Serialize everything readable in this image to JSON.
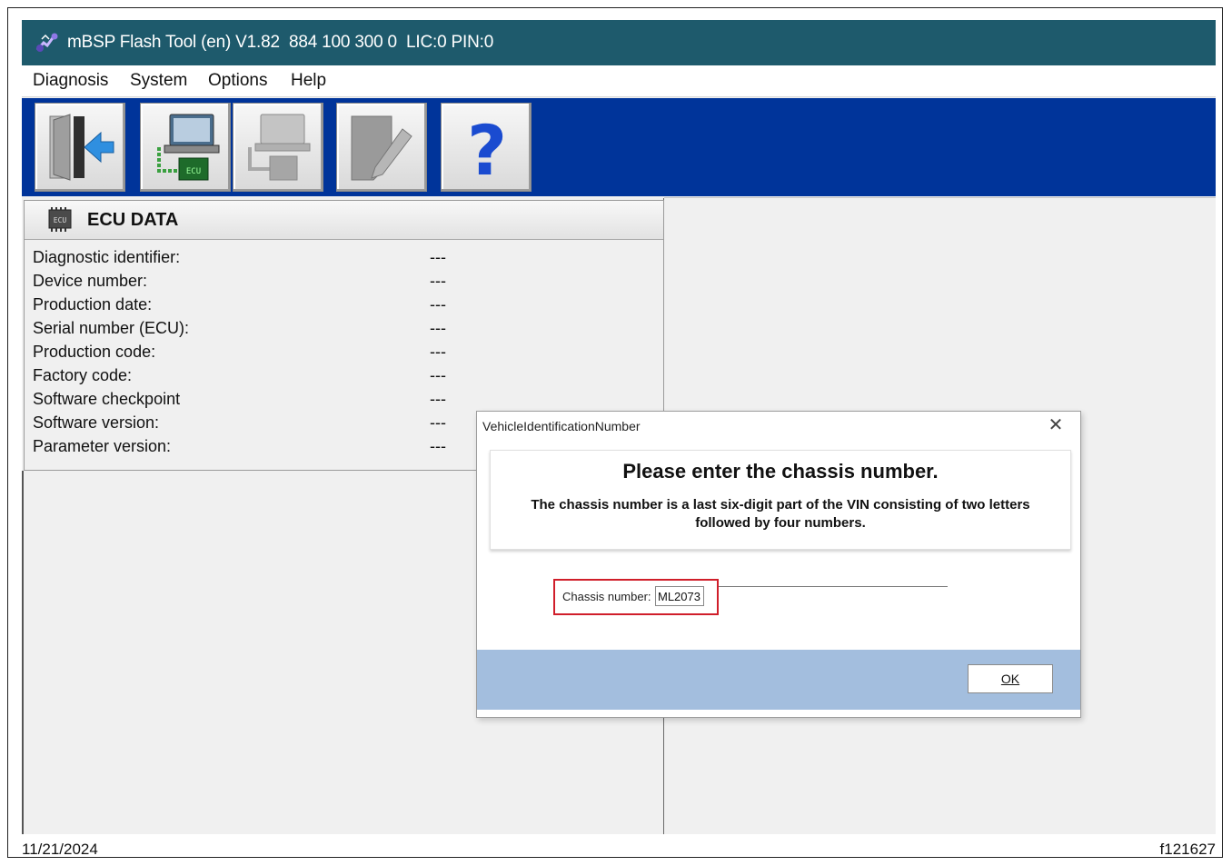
{
  "window": {
    "title": "mBSP Flash Tool (en) V1.82  884 100 300 0  LIC:0 PIN:0",
    "icon": "mbsp-app-icon"
  },
  "menu": [
    "Diagnosis",
    "System",
    "Options",
    "Help"
  ],
  "toolbar": {
    "buttons": [
      {
        "icon": "exit-door-icon"
      },
      {
        "icon": "ecu-connect-icon"
      },
      {
        "icon": "flash-ecu-icon"
      },
      {
        "icon": "edit-parameter-icon"
      },
      {
        "icon": "help-question-icon",
        "glyph": "?"
      }
    ],
    "colors": {
      "background": "#00349a",
      "titlebar": "#1e5a6c"
    }
  },
  "ecu_panel": {
    "title": "ECU DATA",
    "icon": "ecu-chip-icon",
    "chip_text": "ECU",
    "rows": [
      {
        "label": "Diagnostic identifier:",
        "value": "---"
      },
      {
        "label": "Device number:",
        "value": "---"
      },
      {
        "label": "Production date:",
        "value": "---"
      },
      {
        "label": "Serial number (ECU):",
        "value": "---"
      },
      {
        "label": "Production code:",
        "value": "---"
      },
      {
        "label": "Factory code:",
        "value": "---"
      },
      {
        "label": "Software checkpoint",
        "value": "---"
      },
      {
        "label": "Software version:",
        "value": "---"
      },
      {
        "label": "Parameter version:",
        "value": "---"
      }
    ]
  },
  "dialog": {
    "title": "VehicleIdentificationNumber",
    "close_glyph": "✕",
    "heading": "Please enter the chassis number.",
    "description": "The chassis number is a last six-digit part of the VIN consisting of two letters followed by four numbers.",
    "chassis_label": "Chassis number:",
    "chassis_value": "ML2073",
    "ok_label": "OK",
    "highlight_color": "#d01e2a",
    "footer_color": "#a3bede"
  },
  "page_footer": {
    "date": "11/21/2024",
    "code": "f121627"
  }
}
